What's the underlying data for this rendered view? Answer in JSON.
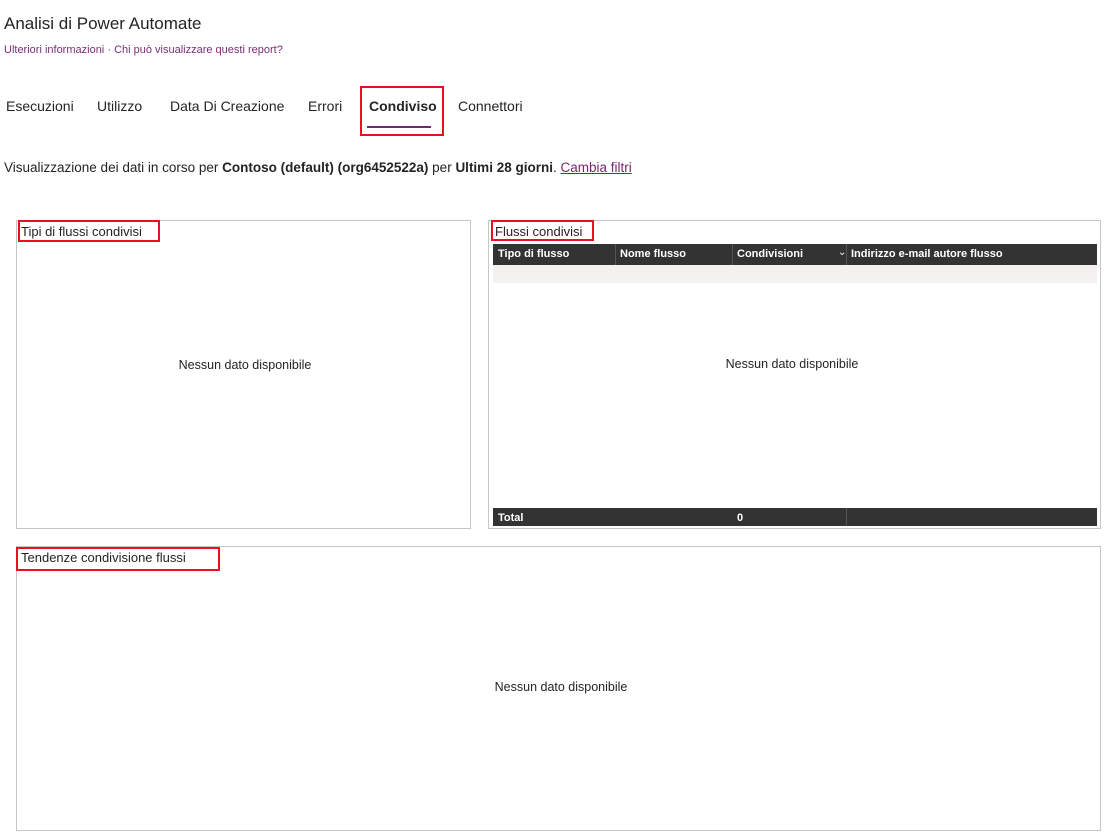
{
  "header": {
    "title": "Analisi di Power Automate",
    "more_info": "Ulteriori informazioni",
    "separator": "·",
    "who_can_view": "Chi può visualizzare questi report?"
  },
  "tabs": [
    {
      "label": "Esecuzioni",
      "active": false
    },
    {
      "label": "Utilizzo",
      "active": false
    },
    {
      "label": "Data Di Creazione",
      "active": false
    },
    {
      "label": "Errori",
      "active": false
    },
    {
      "label": "Condiviso",
      "active": true
    },
    {
      "label": "Connettori",
      "active": false
    }
  ],
  "filter": {
    "prefix": "Visualizzazione dei dati in corso per ",
    "environment": "Contoso (default) (org6452522a)",
    "middle": " per ",
    "period": "Ultimi 28 giorni",
    "suffix": ". ",
    "change_link": "Cambia filtri"
  },
  "panels": {
    "types": {
      "title": "Tipi di flussi condivisi",
      "empty": "Nessun dato disponibile"
    },
    "shared_flows": {
      "title": "Flussi condivisi",
      "columns": [
        "Tipo di flusso",
        "Nome flusso",
        "Condivisioni",
        "Indirizzo e-mail autore flusso"
      ],
      "sort_icon": "chevron-down-icon",
      "empty": "Nessun dato disponibile",
      "total_label": "Total",
      "total_value": "0"
    },
    "trends": {
      "title": "Tendenze condivisione flussi",
      "empty": "Nessun dato disponibile"
    }
  },
  "colors": {
    "accent": "#742774",
    "link": "#7a2d78",
    "highlight": "#e81123",
    "table_header": "#333333"
  }
}
